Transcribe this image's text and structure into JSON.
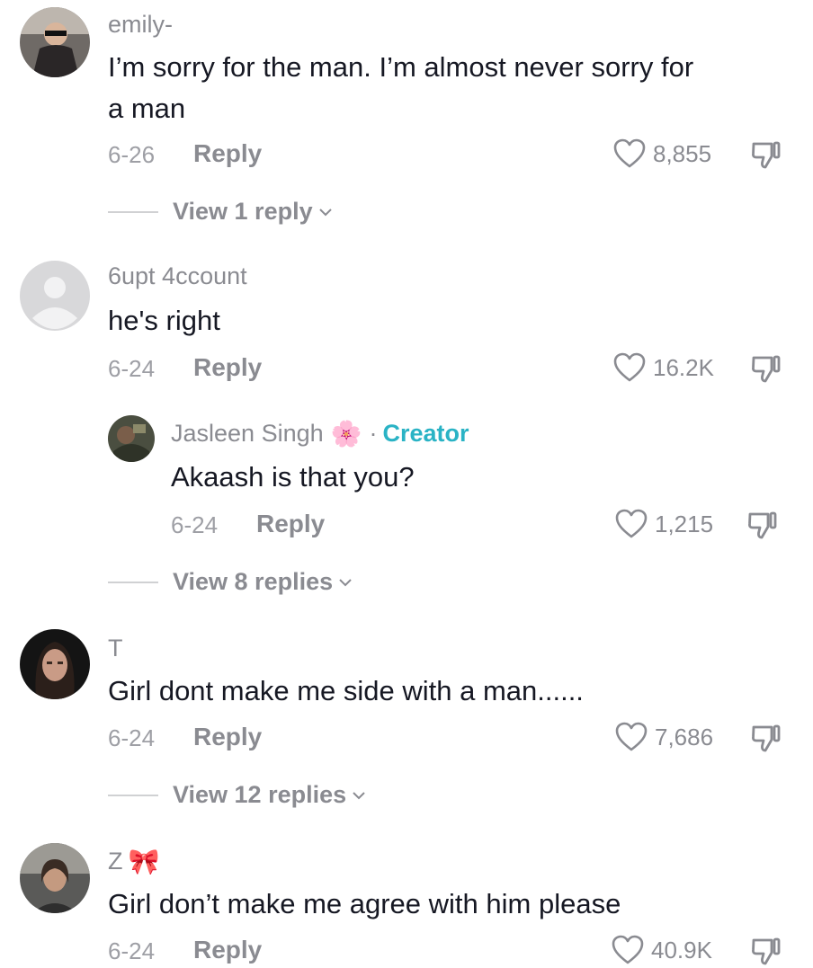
{
  "comments": [
    {
      "username": "emily-",
      "text_line1": "I’m sorry for the man. I’m almost never sorry for",
      "text_line2": "a man",
      "date": "6-26",
      "reply_label": "Reply",
      "likes": "8,855",
      "view_replies": "View 1 reply"
    },
    {
      "username": "6upt 4ccount",
      "text": "he's right",
      "date": "6-24",
      "reply_label": "Reply",
      "likes": "16.2K"
    },
    {
      "username": "Jasleen Singh",
      "flower_emoji": "🌸",
      "creator_separator": "·",
      "creator_label": "Creator",
      "text": "Akaash is that you?",
      "date": "6-24",
      "reply_label": "Reply",
      "likes": "1,215",
      "view_replies": "View 8 replies"
    },
    {
      "username": "T",
      "text": "Girl dont make me side with a man......",
      "date": "6-24",
      "reply_label": "Reply",
      "likes": "7,686",
      "view_replies": "View 12 replies"
    },
    {
      "username": "Z",
      "bow_emoji": "🎀",
      "text": "Girl don’t make me agree with him please",
      "date": "6-24",
      "reply_label": "Reply",
      "likes": "40.9K"
    }
  ],
  "colors": {
    "text": "#161823",
    "secondary": "#8a8b91",
    "creator": "#2ab3c5",
    "divider": "#d0d1d3"
  },
  "icons": [
    "heart-icon",
    "dislike-icon",
    "chevron-down-icon",
    "flower-emoji",
    "bow-emoji"
  ]
}
